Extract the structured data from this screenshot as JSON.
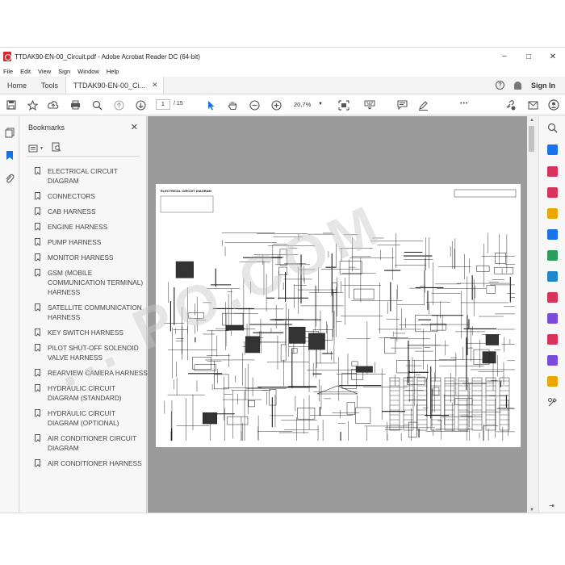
{
  "window": {
    "title": "TTDAK90-EN-00_Circuit.pdf - Adobe Acrobat Reader DC (64-bit)",
    "controls": [
      "−",
      "□",
      "✕"
    ]
  },
  "menu": [
    "File",
    "Edit",
    "View",
    "Sign",
    "Window",
    "Help"
  ],
  "tabs": {
    "home": "Home",
    "tools": "Tools",
    "document": "TTDAK90-EN-00_Ci...",
    "close": "✕",
    "sign_in": "Sign In",
    "help_glyph": "?"
  },
  "toolbar": {
    "page_current": "1",
    "page_total": "/ 15",
    "zoom": "20,7%",
    "more": "•••",
    "icons": [
      "save-icon",
      "star-icon",
      "upload-icon",
      "print-icon",
      "search-zoom-icon",
      "page-up-icon",
      "page-down-icon",
      "select-arrow-icon",
      "hand-icon",
      "zoom-out-icon",
      "zoom-in-icon",
      "fit-page-icon",
      "keyboard-icon",
      "comment-icon",
      "pen-icon",
      "share-link-icon",
      "mail-icon",
      "account-icon"
    ]
  },
  "bookmarks": {
    "header": "Bookmarks",
    "close": "✕",
    "items": [
      "ELECTRICAL CIRCUIT DIAGRAM",
      "CONNECTORS",
      "CAB HARNESS",
      "ENGINE HARNESS",
      "PUMP HARNESS",
      "MONITOR HARNESS",
      "GSM (MOBILE COMMUNICATION TERMINAL) HARNESS",
      "SATELLITE COMMUNICATION HARNESS",
      "KEY SWITCH HARNESS",
      "PILOT SHUT-OFF SOLENOID VALVE HARNESS",
      "REARVIEW CAMERA HARNESS",
      "HYDRAULIC CIRCUIT DIAGRAM (STANDARD)",
      "HYDRAULIC CIRCUIT DIAGRAM (OPTIONAL)",
      "AIR CONDITIONER CIRCUIT DIAGRAM",
      "AIR CONDITIONER HARNESS"
    ]
  },
  "document": {
    "page_heading": "ELECTRICAL CIRCUIT DIAGRAM"
  },
  "watermark": "... PO.COM",
  "colors": {
    "acrobat_red": "#d4272e",
    "selected_tool_blue": "#1473e6",
    "doc_background": "#9b9b9b",
    "right_rail_icons": [
      "#1a73e8",
      "#d8335b",
      "#e9a800",
      "#2d9d5b",
      "#7a4cd9",
      "#1e88c8",
      "#d8335b"
    ]
  }
}
